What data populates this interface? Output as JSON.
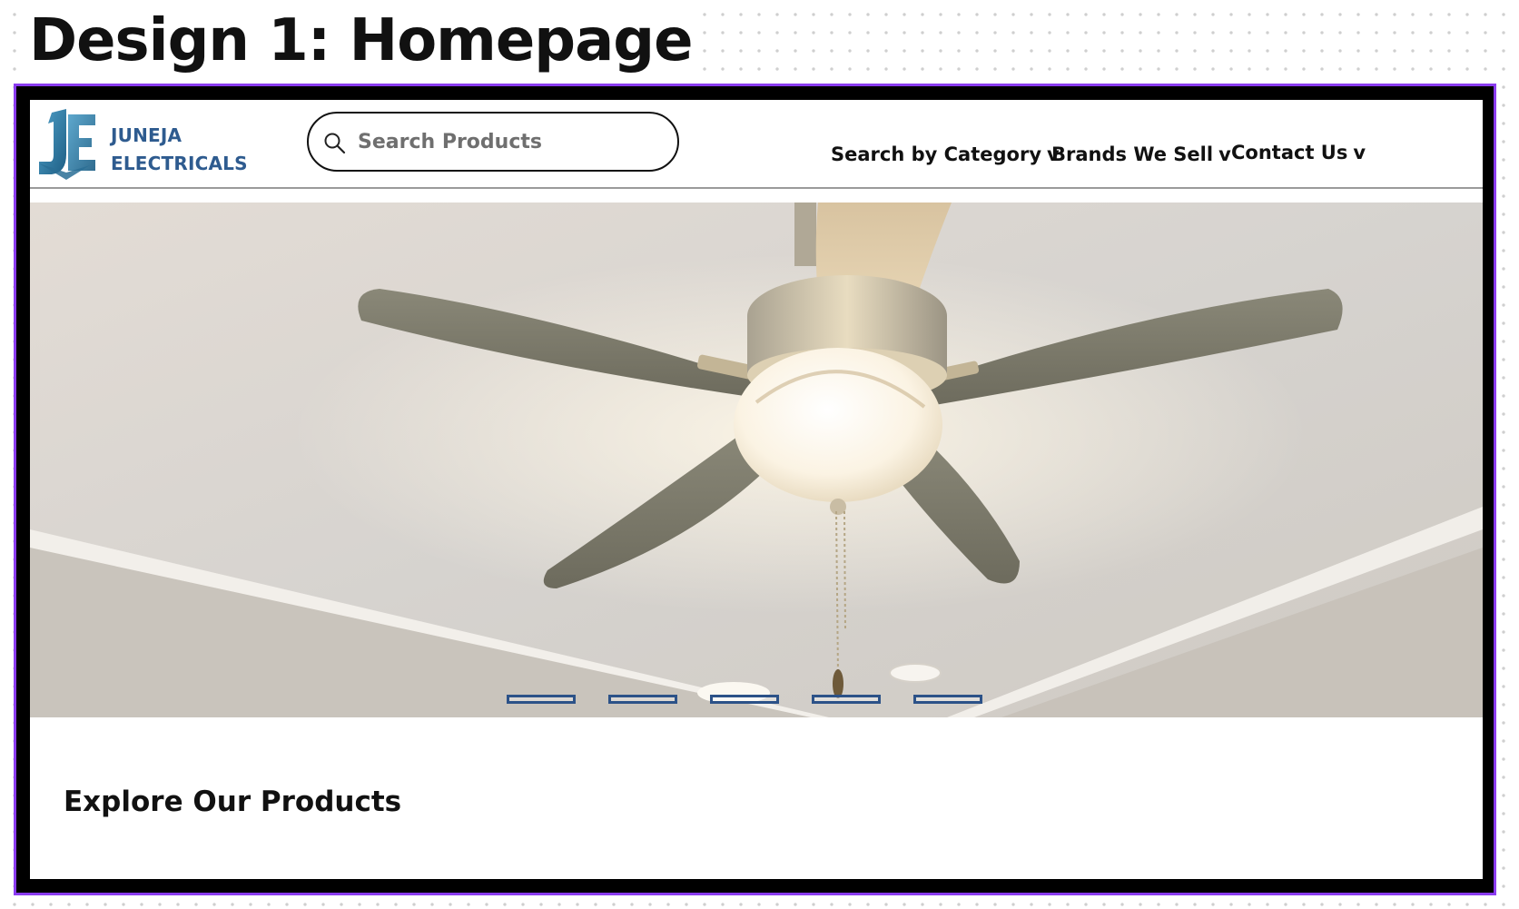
{
  "design_title": "Design 1: Homepage",
  "logo": {
    "line1": "JUNEJA",
    "line2": "ELECTRICALS",
    "icon": "je-monogram-logo"
  },
  "search": {
    "placeholder": "Search Products",
    "value": "",
    "icon": "search-icon"
  },
  "nav": {
    "items": [
      {
        "label": "Search by Category",
        "chevron": "v"
      },
      {
        "label": "Brands We Sell",
        "chevron": "v"
      },
      {
        "label": "Contact Us",
        "chevron": "v"
      }
    ]
  },
  "hero": {
    "image": "ceiling-fan-with-light",
    "slide_count": 5
  },
  "sections": {
    "explore_title": "Explore Our Products"
  },
  "colors": {
    "brand_blue": "#2e5b8f",
    "dot_blue": "#2c5288",
    "selection_purple": "#8b3cf0",
    "frame_black": "#000000"
  }
}
